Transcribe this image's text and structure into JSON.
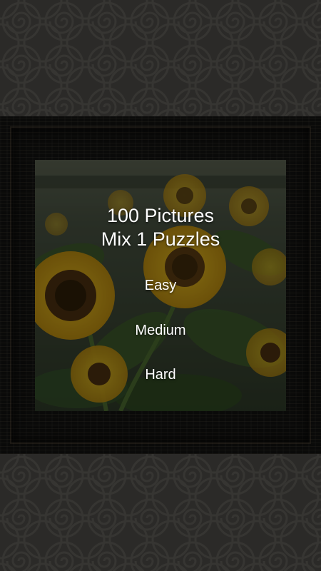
{
  "title": {
    "line1": "100 Pictures",
    "line2": "Mix 1 Puzzles"
  },
  "menu": {
    "easy": "Easy",
    "medium": "Medium",
    "hard": "Hard"
  },
  "background": {
    "pattern": "swirl-pattern",
    "picture": "sunflowers"
  },
  "colors": {
    "background": "#2b2a28",
    "frame": "#0a0a09",
    "text": "#ffffff"
  }
}
